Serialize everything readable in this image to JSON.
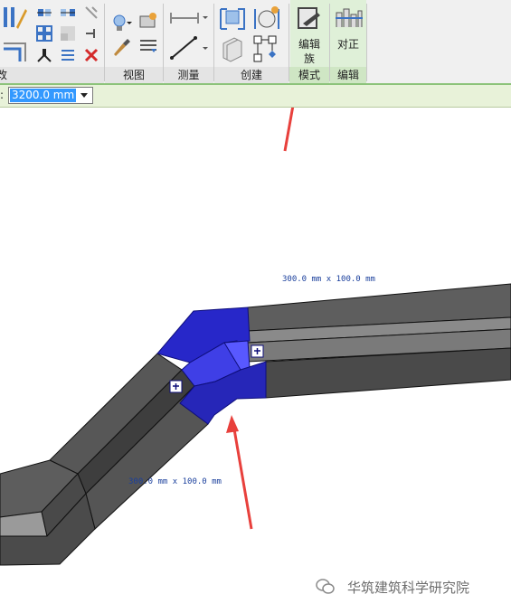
{
  "ribbon": {
    "panels": [
      {
        "label": "改"
      },
      {
        "label": "视图"
      },
      {
        "label": "测量"
      },
      {
        "label": "创建"
      },
      {
        "label": "模式"
      },
      {
        "label": "编辑"
      }
    ],
    "buttons": {
      "edit_family_line1": "编辑",
      "edit_family_line2": "族",
      "align_label": "对正"
    }
  },
  "options_bar": {
    "label": ":",
    "value": "3200.0 mm"
  },
  "viewport": {
    "dimension_top": "300.0 mm x 100.0 mm",
    "dimension_bottom": "300.0 mm x 100.0 mm",
    "colors": {
      "duct_dark": "#575757",
      "duct_light": "#9a9a9a",
      "selected": "#2b2bd6",
      "arrow": "#e8403c"
    }
  },
  "watermark": {
    "text": "华筑建筑科学研究院"
  }
}
